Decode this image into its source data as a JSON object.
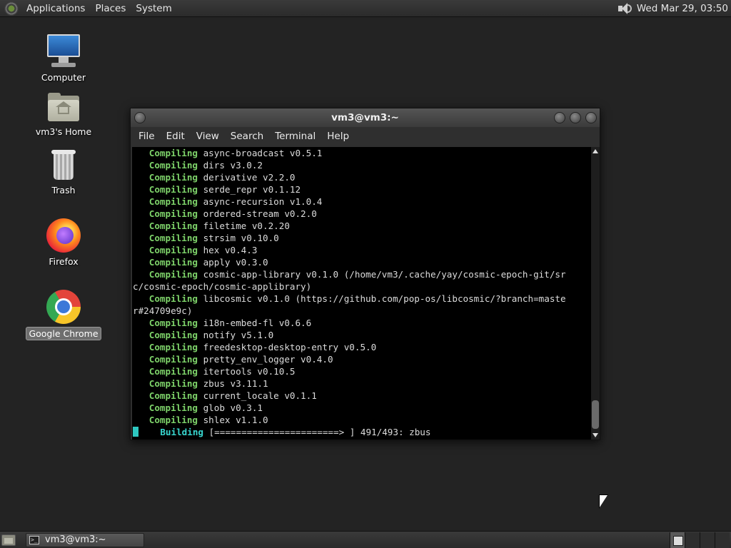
{
  "top_panel": {
    "menus": [
      "Applications",
      "Places",
      "System"
    ],
    "clock": "Wed Mar 29, 03:50"
  },
  "desktop": {
    "icons": [
      {
        "label": "Computer",
        "icon": "computer-icon"
      },
      {
        "label": "vm3's Home",
        "icon": "home-folder-icon"
      },
      {
        "label": "Trash",
        "icon": "trash-icon"
      },
      {
        "label": "Firefox",
        "icon": "firefox-icon"
      },
      {
        "label": "Google Chrome",
        "icon": "chrome-icon",
        "selected": true
      }
    ]
  },
  "terminal": {
    "title": "vm3@vm3:~",
    "menu": [
      "File",
      "Edit",
      "View",
      "Search",
      "Terminal",
      "Help"
    ],
    "lines": [
      {
        "kw": "Compiling",
        "text": " async-broadcast v0.5.1"
      },
      {
        "kw": "Compiling",
        "text": " dirs v3.0.2"
      },
      {
        "kw": "Compiling",
        "text": " derivative v2.2.0"
      },
      {
        "kw": "Compiling",
        "text": " serde_repr v0.1.12"
      },
      {
        "kw": "Compiling",
        "text": " async-recursion v1.0.4"
      },
      {
        "kw": "Compiling",
        "text": " ordered-stream v0.2.0"
      },
      {
        "kw": "Compiling",
        "text": " filetime v0.2.20"
      },
      {
        "kw": "Compiling",
        "text": " strsim v0.10.0"
      },
      {
        "kw": "Compiling",
        "text": " hex v0.4.3"
      },
      {
        "kw": "Compiling",
        "text": " apply v0.3.0"
      },
      {
        "kw": "Compiling",
        "text": " cosmic-app-library v0.1.0 (/home/vm3/.cache/yay/cosmic-epoch-git/sr"
      },
      {
        "kw": "",
        "text": "c/cosmic-epoch/cosmic-applibrary)"
      },
      {
        "kw": "Compiling",
        "text": " libcosmic v0.1.0 (https://github.com/pop-os/libcosmic/?branch=maste"
      },
      {
        "kw": "",
        "text": "r#24709e9c)"
      },
      {
        "kw": "Compiling",
        "text": " i18n-embed-fl v0.6.6"
      },
      {
        "kw": "Compiling",
        "text": " notify v5.1.0"
      },
      {
        "kw": "Compiling",
        "text": " freedesktop-desktop-entry v0.5.0"
      },
      {
        "kw": "Compiling",
        "text": " pretty_env_logger v0.4.0"
      },
      {
        "kw": "Compiling",
        "text": " itertools v0.10.5"
      },
      {
        "kw": "Compiling",
        "text": " zbus v3.11.1"
      },
      {
        "kw": "Compiling",
        "text": " current_locale v0.1.1"
      },
      {
        "kw": "Compiling",
        "text": " glob v0.3.1"
      },
      {
        "kw": "Compiling",
        "text": " shlex v1.1.0"
      }
    ],
    "building_label": "Building",
    "building_text": " [=======================> ] 491/493: zbus"
  },
  "taskbar": {
    "task_title": "vm3@vm3:~"
  },
  "colors": {
    "compiling": "#7ed36a",
    "building": "#38d7d0",
    "desktop_bg": "#232323"
  }
}
